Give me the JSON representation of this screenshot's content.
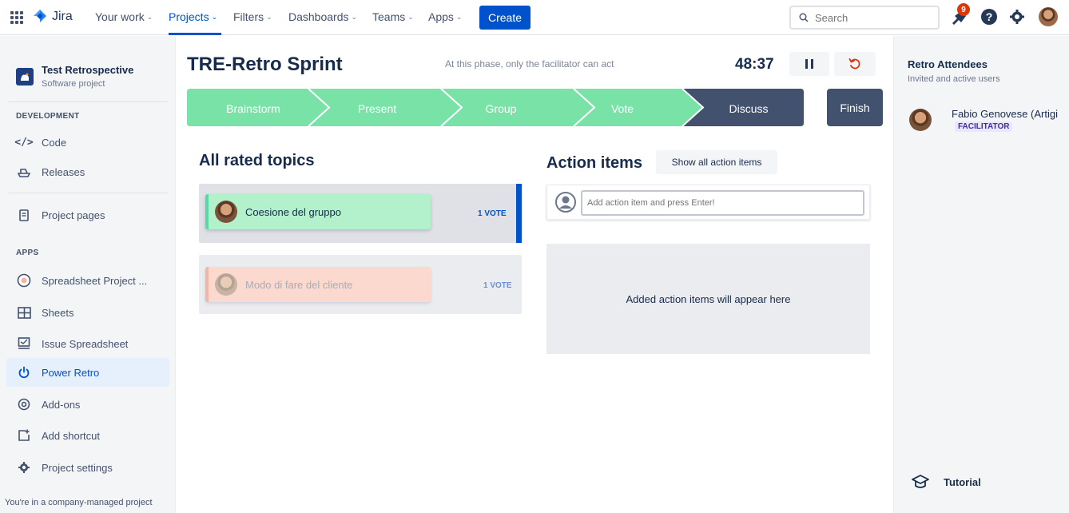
{
  "topnav": {
    "logo_text": "Jira",
    "items": [
      {
        "label": "Your work"
      },
      {
        "label": "Projects"
      },
      {
        "label": "Filters"
      },
      {
        "label": "Dashboards"
      },
      {
        "label": "Teams"
      },
      {
        "label": "Apps"
      }
    ],
    "create_label": "Create",
    "search_placeholder": "Search",
    "notification_count": "9",
    "help_glyph": "?"
  },
  "sidebar": {
    "project_name": "Test Retrospective",
    "project_type": "Software project",
    "section_development": "DEVELOPMENT",
    "dev_items": [
      {
        "label": "Code",
        "icon": "code-icon"
      },
      {
        "label": "Releases",
        "icon": "ship-icon"
      }
    ],
    "project_pages_label": "Project pages",
    "section_apps": "APPS",
    "app_items": [
      {
        "label": "Spreadsheet Project ...",
        "icon": "spreadsheet-project-icon"
      },
      {
        "label": "Sheets",
        "icon": "sheets-icon"
      },
      {
        "label": "Issue Spreadsheet",
        "icon": "issue-spreadsheet-icon"
      },
      {
        "label": "Power Retro",
        "icon": "power-icon"
      },
      {
        "label": "Add-ons",
        "icon": "addons-icon"
      },
      {
        "label": "Add shortcut",
        "icon": "add-shortcut-icon"
      },
      {
        "label": "Project settings",
        "icon": "gear-icon"
      }
    ],
    "footer_note": "You're in a company-managed project"
  },
  "board": {
    "title": "TRE-Retro Sprint",
    "phase_note": "At this phase, only the facilitator can act",
    "timer": "48:37",
    "steps": [
      {
        "label": "Brainstorm",
        "state": "done"
      },
      {
        "label": "Present",
        "state": "done"
      },
      {
        "label": "Group",
        "state": "done"
      },
      {
        "label": "Vote",
        "state": "done"
      },
      {
        "label": "Discuss",
        "state": "current"
      }
    ],
    "finish_label": "Finish",
    "colors": {
      "done": "#79e2a6",
      "current": "#42526e",
      "reset": "#de350b"
    }
  },
  "rated_topics": {
    "title": "All rated topics",
    "topics": [
      {
        "label": "Coesione del gruppo",
        "votes": "1 VOTE",
        "color": "#b3f0cc",
        "accent": "#57d9a3"
      },
      {
        "label": "Modo di fare del cliente",
        "votes": "1 VOTE",
        "color": "#fbd9cf",
        "accent": "#f4b5a2"
      }
    ]
  },
  "action_items": {
    "title": "Action items",
    "show_all_label": "Show all action items",
    "input_placeholder": "Add action item and press Enter!",
    "empty_message": "Added action items will appear here"
  },
  "attendees": {
    "title": "Retro Attendees",
    "subtitle": "Invited and active users",
    "list": [
      {
        "name": "Fabio Genovese (Artigi",
        "role": "FACILITATOR"
      }
    ],
    "tutorial_label": "Tutorial"
  }
}
